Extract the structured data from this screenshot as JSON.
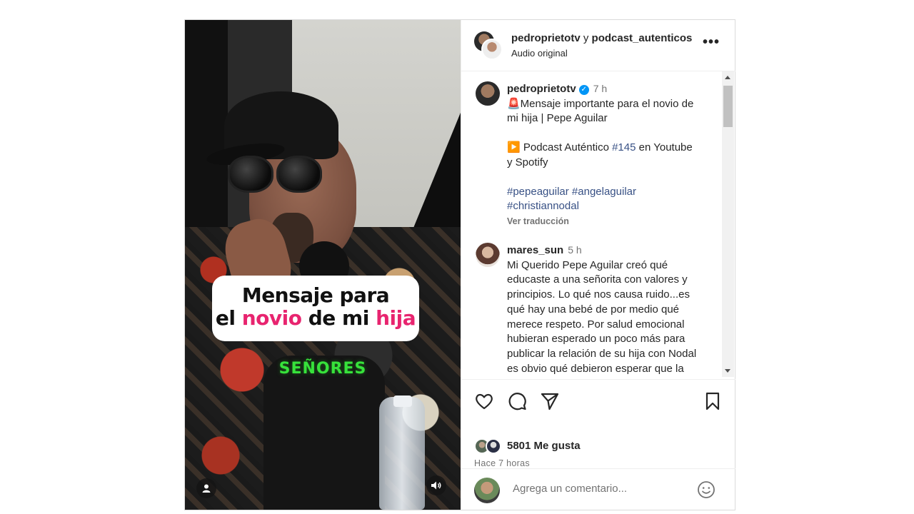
{
  "media": {
    "caption_line1": "Mensaje para",
    "caption_line2_prefix": "el ",
    "caption_line2_pink1": "novio",
    "caption_line2_mid": " de mi ",
    "caption_line2_pink2": "hija",
    "overlay_text": "SEÑORES",
    "accent_pink": "#e8246f",
    "accent_green": "#37e23b"
  },
  "header": {
    "user1": "pedroprietotv",
    "joiner": "y",
    "user2": "podcast_autenticos",
    "subtitle": "Audio original",
    "more_label": "•••"
  },
  "caption_post": {
    "username": "pedroprietotv",
    "verified": true,
    "time": "7 h",
    "line1": "🚨Mensaje importante para el novio de mi hija | Pepe Aguilar",
    "line2_prefix": "▶️ Podcast Auténtico ",
    "line2_tag": "#145",
    "line2_suffix": " en Youtube y Spotify",
    "tags": [
      "#pepeaguilar",
      "#angelaguilar",
      "#christiannodal"
    ],
    "translate": "Ver traducción"
  },
  "comment": {
    "username": "mares_sun",
    "time": "5 h",
    "text": "Mi Querido Pepe Aguilar creó qué educaste a una señorita con valores y principios. Lo qué nos causa ruido...es qué hay una bebé de por medio qué merece respeto. Por salud emocional hubieran esperado un poco más para publicar la relación de su hija con Nodal es obvio qué debieron esperar que la"
  },
  "actions": {
    "likes": "5801 Me gusta",
    "ago": "Hace 7 horas"
  },
  "add_comment": {
    "placeholder": "Agrega un comentario..."
  },
  "icons": [
    "heart-icon",
    "comment-icon",
    "share-icon",
    "bookmark-icon",
    "emoji-icon",
    "user-tag-icon",
    "sound-icon",
    "more-icon"
  ],
  "colors": {
    "link": "#385185",
    "verified": "#0095f6",
    "muted": "#737373"
  }
}
